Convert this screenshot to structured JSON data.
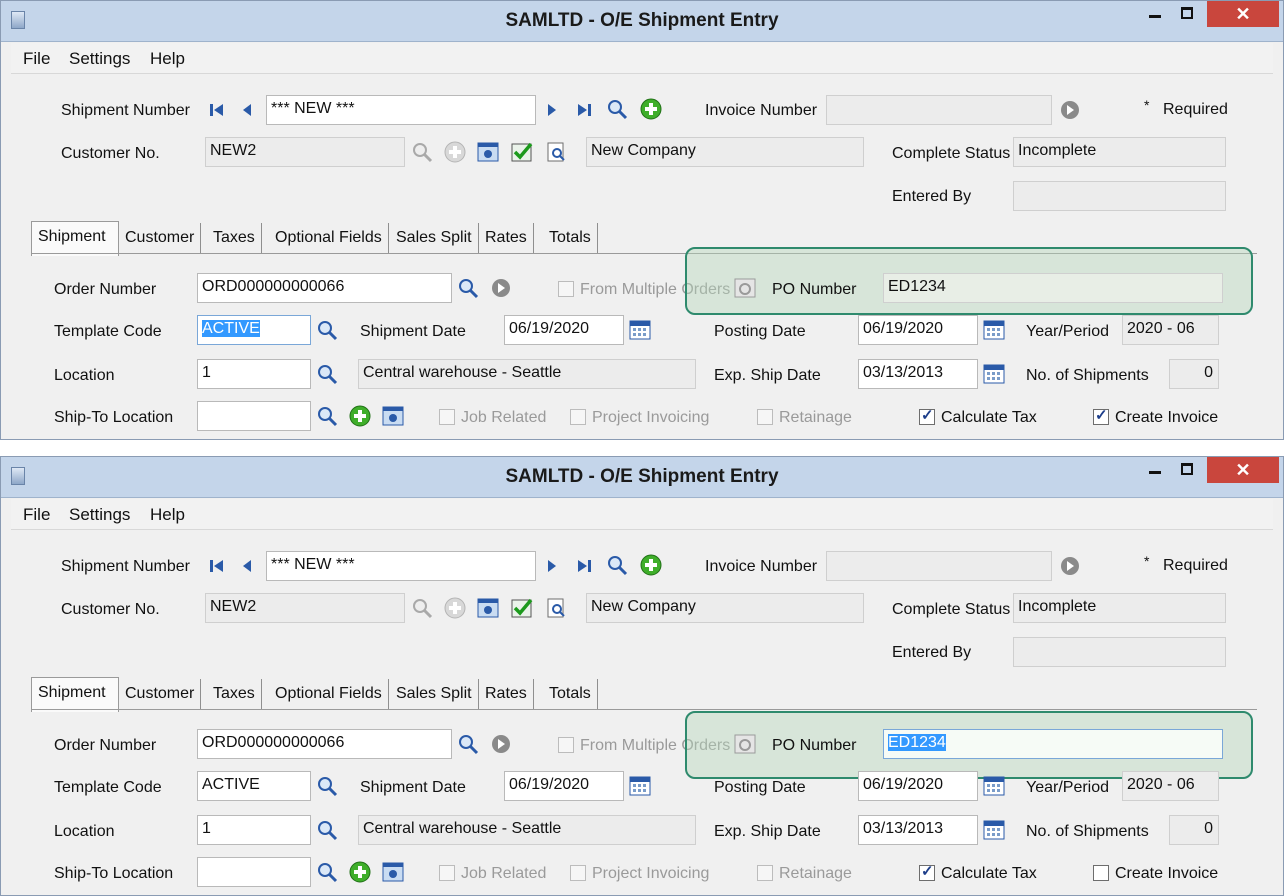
{
  "title": "SAMLTD - O/E Shipment Entry",
  "window_controls": {
    "close": "✕"
  },
  "menu": [
    "File",
    "Settings",
    "Help"
  ],
  "header": {
    "shipment_number_label": "Shipment Number",
    "shipment_number_value": "*** NEW ***",
    "invoice_number_label": "Invoice Number",
    "invoice_number_value": "",
    "required_mark": "*",
    "required_label": "Required",
    "customer_no_label": "Customer No.",
    "customer_no_value": "NEW2",
    "customer_name_value": "New Company",
    "complete_status_label": "Complete Status",
    "complete_status_value": "Incomplete",
    "entered_by_label": "Entered By",
    "entered_by_value": ""
  },
  "tabs": [
    "Shipment",
    "Customer",
    "Taxes",
    "Optional Fields",
    "Sales Split",
    "Rates",
    "Totals"
  ],
  "shipment": {
    "order_number_label": "Order Number",
    "order_number_value": "ORD000000000066",
    "from_multiple_orders_label": "From Multiple Orders",
    "po_number_label": "PO Number",
    "po_number_value": "ED1234",
    "template_code_label": "Template Code",
    "template_code_value": "ACTIVE",
    "shipment_date_label": "Shipment Date",
    "shipment_date_value": "06/19/2020",
    "posting_date_label": "Posting Date",
    "posting_date_value": "06/19/2020",
    "year_period_label": "Year/Period",
    "year_period_value": "2020 - 06",
    "location_label": "Location",
    "location_value": "1",
    "location_desc_value": "Central warehouse - Seattle",
    "exp_ship_date_label": "Exp. Ship Date",
    "exp_ship_date_value": "03/13/2013",
    "no_of_shipments_label": "No. of Shipments",
    "no_of_shipments_value": "0",
    "ship_to_location_label": "Ship-To Location",
    "ship_to_location_value": "",
    "job_related_label": "Job Related",
    "project_invoicing_label": "Project Invoicing",
    "retainage_label": "Retainage",
    "calculate_tax_label": "Calculate Tax",
    "calculate_tax_checked": true,
    "create_invoice_label": "Create Invoice"
  },
  "state_top": {
    "selected_field": "Template Code"
  },
  "state_bottom": {
    "selected_field": "PO Number"
  },
  "colors": {
    "selection": "#3399ff",
    "highlight_border": "#2e8a6d",
    "highlight_fill": "#b4d6ba",
    "title_bar": "#c4d5ea",
    "close_button": "#c9463d"
  }
}
